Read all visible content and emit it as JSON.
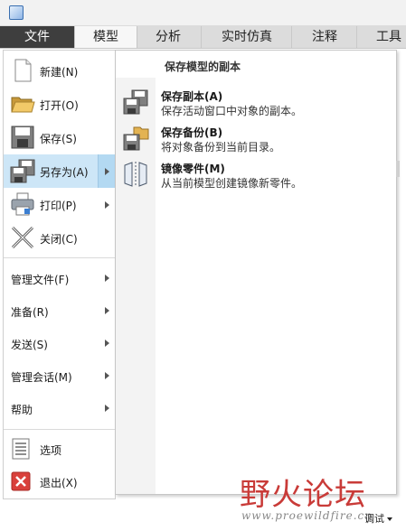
{
  "tabs": {
    "file": "文件",
    "model": "模型",
    "analysis": "分析",
    "simulation": "实时仿真",
    "annotate": "注释",
    "tools": "工具"
  },
  "menu": {
    "new": "新建(N)",
    "open": "打开(O)",
    "save": "保存(S)",
    "save_as": "另存为(A)",
    "print": "打印(P)",
    "close": "关闭(C)",
    "manage_file": "管理文件(F)",
    "prepare": "准备(R)",
    "send": "发送(S)",
    "manage_session": "管理会话(M)",
    "help": "帮助",
    "options": "选项",
    "exit": "退出(X)"
  },
  "submenu": {
    "title": "保存模型的副本",
    "items": [
      {
        "title": "保存副本(A)",
        "desc": "保存活动窗口中对象的副本。"
      },
      {
        "title": "保存备份(B)",
        "desc": "将对象备份到当前目录。"
      },
      {
        "title": "镜像零件(M)",
        "desc": "从当前模型创建镜像新零件。"
      }
    ]
  },
  "watermark": {
    "text": "野火论坛",
    "url": "www.proewildfire.cn"
  },
  "status": {
    "debug": "调试"
  },
  "colors": {
    "file_tab": "#3e3e3e",
    "selected": "#cde6f7",
    "watermark": "#c93b38"
  }
}
